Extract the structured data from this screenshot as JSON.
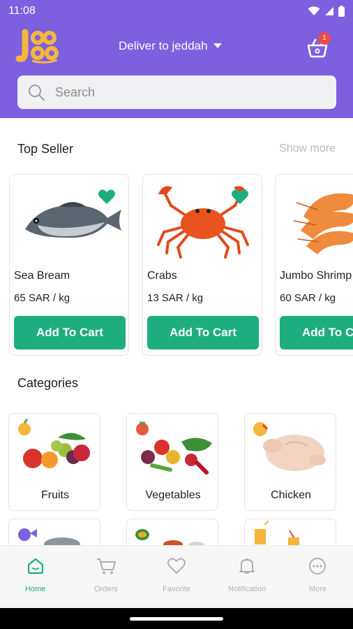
{
  "status_bar": {
    "time": "11:08"
  },
  "header": {
    "deliver_label": "Deliver to jeddah",
    "cart_count": "1",
    "search_placeholder": "Search"
  },
  "top_seller": {
    "title": "Top Seller",
    "show_more": "Show more",
    "add_label": "Add To Cart",
    "products": [
      {
        "name": "Sea Bream",
        "price": "65 SAR / kg"
      },
      {
        "name": "Crabs",
        "price": "13 SAR / kg"
      },
      {
        "name": "Jumbo Shrimp",
        "price": "60 SAR / kg"
      }
    ]
  },
  "categories": {
    "title": "Categories",
    "items": [
      {
        "label": "Fruits"
      },
      {
        "label": "Vegetables"
      },
      {
        "label": "Chicken"
      }
    ]
  },
  "bottom_nav": {
    "items": [
      {
        "label": "Home",
        "icon": "home-icon"
      },
      {
        "label": "Orders",
        "icon": "cart-icon"
      },
      {
        "label": "Favorite",
        "icon": "heart-icon"
      },
      {
        "label": "Notification",
        "icon": "bell-icon"
      },
      {
        "label": "More",
        "icon": "more-icon"
      }
    ]
  },
  "colors": {
    "brand_purple": "#7d5fe0",
    "accent_green": "#1ead7e",
    "badge_red": "#ef4b4b"
  }
}
